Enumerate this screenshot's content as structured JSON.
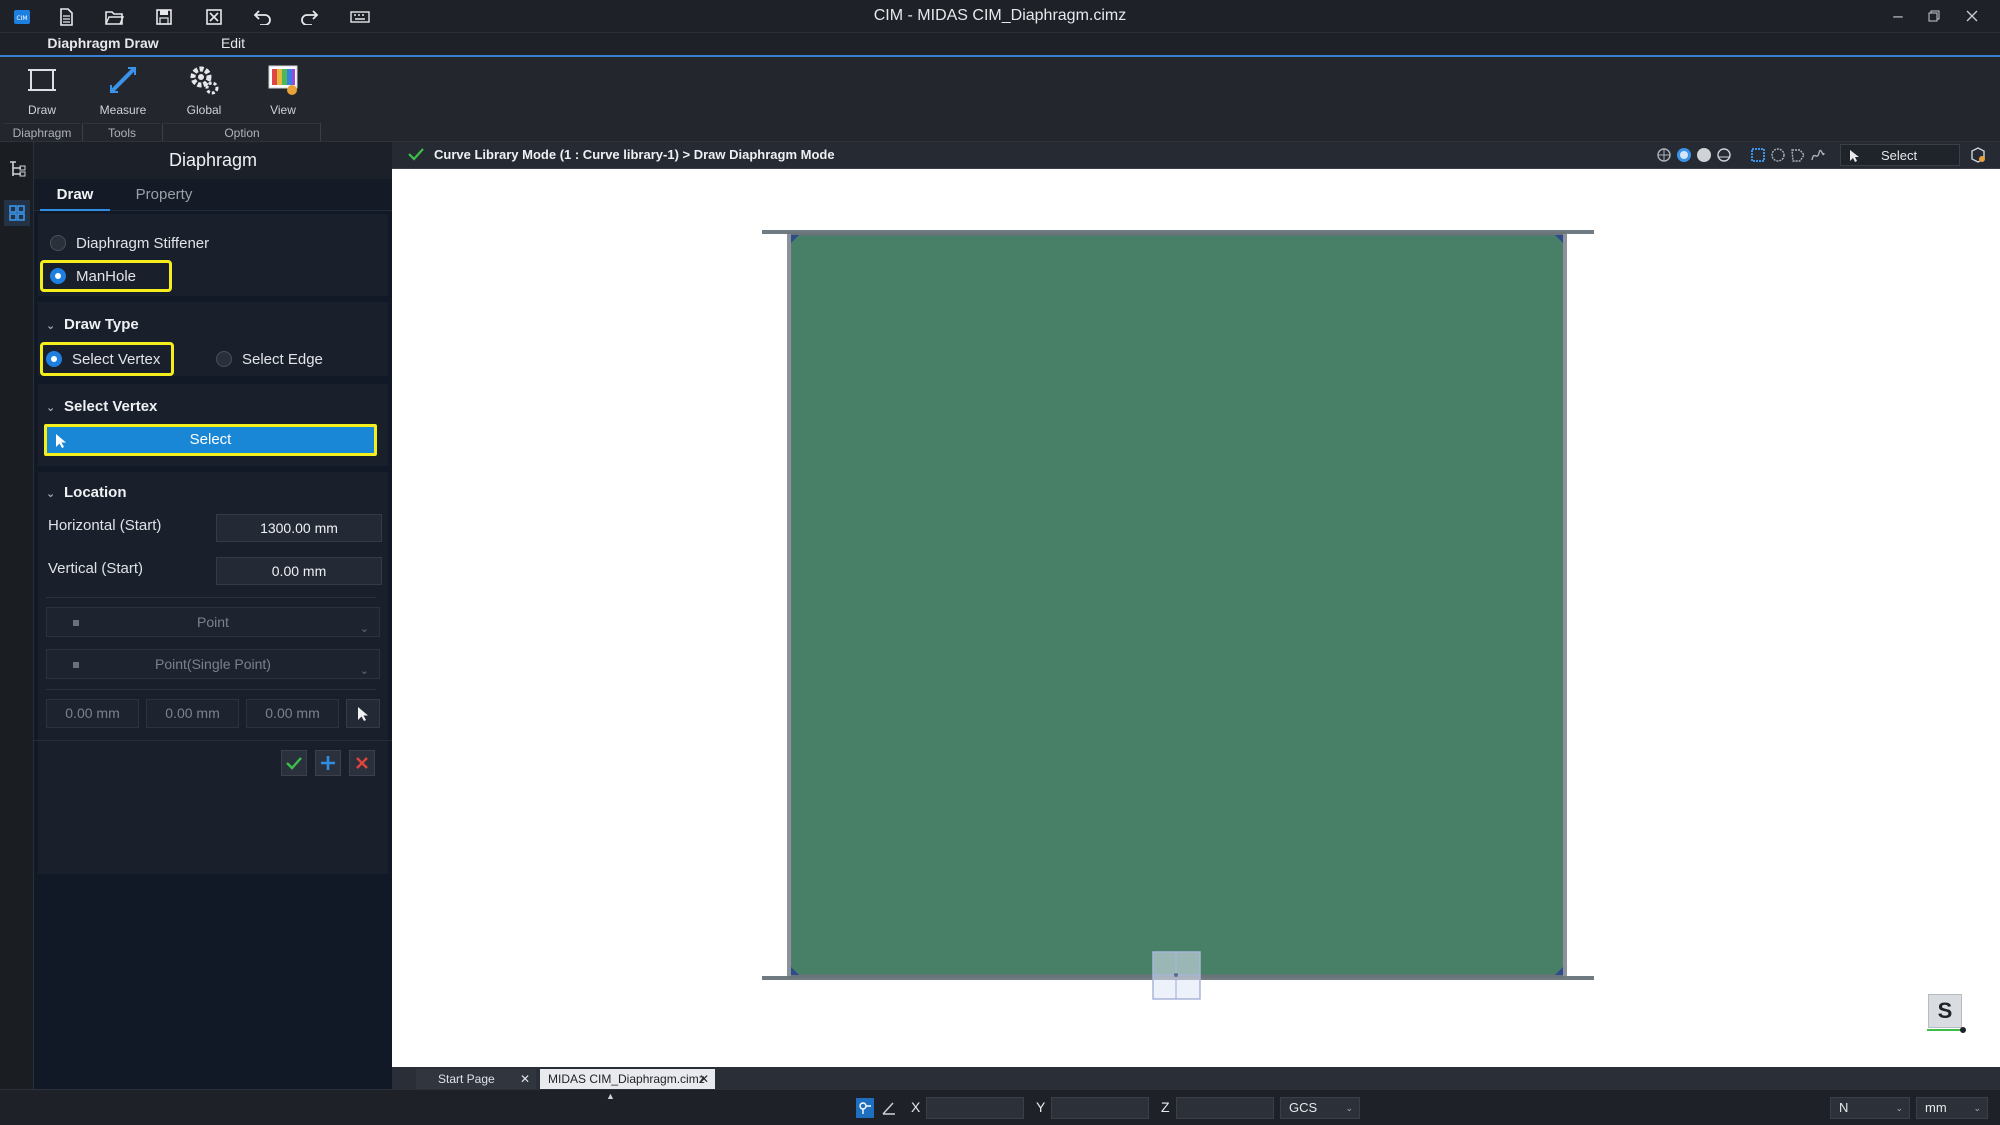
{
  "window": {
    "title": "CIM - MIDAS CIM_Diaphragm.cimz",
    "quick_access_icons": [
      "app-logo-icon",
      "new-file-icon",
      "open-folder-icon",
      "save-icon",
      "close-file-icon",
      "undo-icon",
      "redo-icon",
      "keyboard-icon"
    ],
    "controls": [
      "minimize",
      "restore",
      "close"
    ]
  },
  "ribbon": {
    "tabs": [
      {
        "label": "Diaphragm Draw",
        "active": true
      },
      {
        "label": "Edit",
        "active": false
      }
    ],
    "buttons": {
      "draw": "Draw",
      "measure": "Measure",
      "global": "Global",
      "view": "View"
    },
    "groups": {
      "diaphragm": "Diaphragm",
      "tools": "Tools",
      "option": "Option"
    }
  },
  "panel": {
    "title": "Diaphragm",
    "tabs": {
      "draw": "Draw",
      "property": "Property"
    },
    "object_type": {
      "stiffener": "Diaphragm Stiffener",
      "manhole": "ManHole",
      "selected": "ManHole"
    },
    "draw_type": {
      "title": "Draw Type",
      "select_vertex": "Select Vertex",
      "select_edge": "Select Edge",
      "selected": "Select Vertex"
    },
    "select_vertex": {
      "title": "Select Vertex",
      "button": "Select"
    },
    "location": {
      "title": "Location",
      "horizontal_label": "Horizontal (Start)",
      "horizontal_value": "1300.00 mm",
      "vertical_label": "Vertical (Start)",
      "vertical_value": "0.00 mm",
      "point_type": "Point",
      "point_mode": "Point(Single Point)",
      "coords": [
        "0.00 mm",
        "0.00 mm",
        "0.00 mm"
      ]
    }
  },
  "viewport": {
    "mode_path": "Curve Library Mode (1 : Curve library-1) > Draw Diaphragm Mode",
    "select_mode": "Select",
    "plate_color": "#477f67",
    "badge": "S"
  },
  "doc_tabs": [
    {
      "label": "Start Page",
      "active": false
    },
    {
      "label": "MIDAS CIM_Diaphragm.cimz",
      "active": true
    }
  ],
  "statusbar": {
    "x_label": "X",
    "y_label": "Y",
    "z_label": "Z",
    "coord_system": "GCS",
    "force_unit": "N",
    "length_unit": "mm"
  },
  "colors": {
    "accent": "#1987d6",
    "highlight": "#f3ee1c",
    "confirm": "#3bbf4a",
    "add": "#2f8de4",
    "cancel": "#e0443a"
  }
}
